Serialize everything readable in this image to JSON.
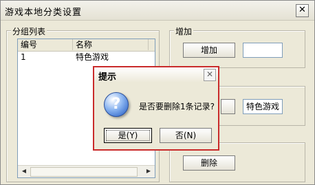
{
  "window": {
    "title": "游戏本地分类设置",
    "close": "✕"
  },
  "group_list": {
    "label": "分组列表",
    "columns": [
      "编号",
      "名称"
    ],
    "rows": [
      {
        "id": "1",
        "name": "特色游戏"
      }
    ],
    "scroll_left": "◀",
    "scroll_right": "▶"
  },
  "group_add": {
    "label": "增加",
    "button": "增加",
    "input_value": ""
  },
  "group_edit": {
    "input_value": "特色游戏"
  },
  "group_delete": {
    "button": "删除"
  },
  "dialog": {
    "title": "提示",
    "close": "✕",
    "icon_glyph": "?",
    "icon": "question-icon",
    "message": "是否要删除1条记录?",
    "yes": "是(Y)",
    "no": "否(N)"
  }
}
